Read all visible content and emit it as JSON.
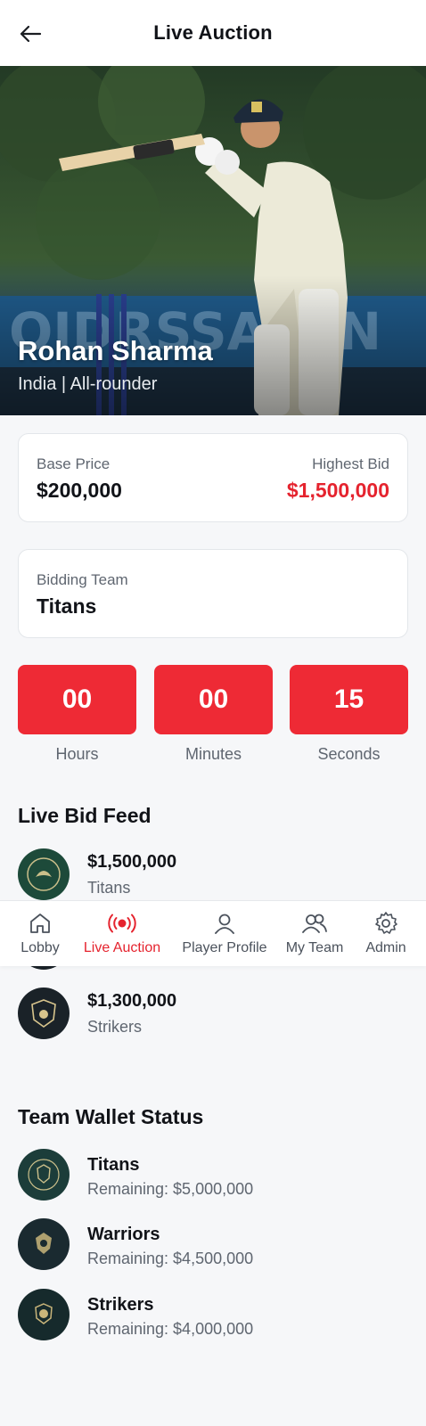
{
  "header": {
    "title": "Live Auction",
    "back_icon": "arrow-left-icon"
  },
  "player": {
    "name": "Rohan Sharma",
    "subtitle": "India | All-rounder"
  },
  "price": {
    "base_label": "Base Price",
    "base_value": "$200,000",
    "highest_label": "Highest Bid",
    "highest_value": "$1,500,000",
    "highest_color": "#e5232e"
  },
  "bidding": {
    "label": "Bidding Team",
    "team": "Titans"
  },
  "timer": {
    "hours": "00",
    "minutes": "00",
    "seconds": "15",
    "hours_label": "Hours",
    "minutes_label": "Minutes",
    "seconds_label": "Seconds",
    "box_color": "#ee2a35"
  },
  "feed": {
    "title": "Live Bid Feed",
    "items": [
      {
        "amount": "$1,500,000",
        "team": "Titans"
      },
      {
        "amount": "$1,300,000",
        "team": "Strikers"
      }
    ]
  },
  "wallet": {
    "title": "Team Wallet Status",
    "remaining_label": "Remaining: ",
    "items": [
      {
        "team": "Titans",
        "remaining": "$5,000,000"
      },
      {
        "team": "Warriors",
        "remaining": "$4,500,000"
      },
      {
        "team": "Strikers",
        "remaining": "$4,000,000"
      }
    ]
  },
  "nav": {
    "items": [
      {
        "label": "Lobby",
        "icon": "home-icon"
      },
      {
        "label": "Live Auction",
        "icon": "broadcast-icon",
        "active": true
      },
      {
        "label": "Player Profile",
        "icon": "user-icon"
      },
      {
        "label": "My Team",
        "icon": "users-icon"
      },
      {
        "label": "Admin",
        "icon": "gear-icon"
      }
    ],
    "active_color": "#e5232e"
  }
}
